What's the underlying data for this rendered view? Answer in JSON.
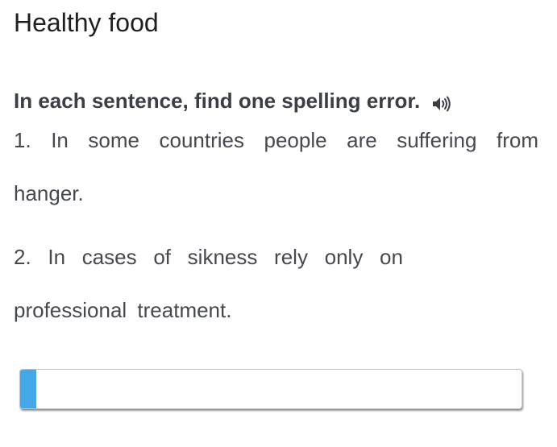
{
  "header": {
    "title": "Healthy food"
  },
  "exercise": {
    "instruction": "In each sentence, find one spelling error.",
    "audio_icon": "speaker-icon",
    "sentences": [
      {
        "line1": [
          "1.",
          "In",
          "some",
          "countries",
          "people",
          "are",
          "suffering",
          "from"
        ],
        "line2": "hanger."
      },
      {
        "line1": [
          "2.",
          "In",
          "cases",
          "of",
          "sikness",
          "rely",
          "only",
          "on"
        ],
        "line2": "professional treatment."
      }
    ],
    "answer": {
      "value": "",
      "placeholder": "",
      "accent_color": "#44a8e8"
    }
  }
}
